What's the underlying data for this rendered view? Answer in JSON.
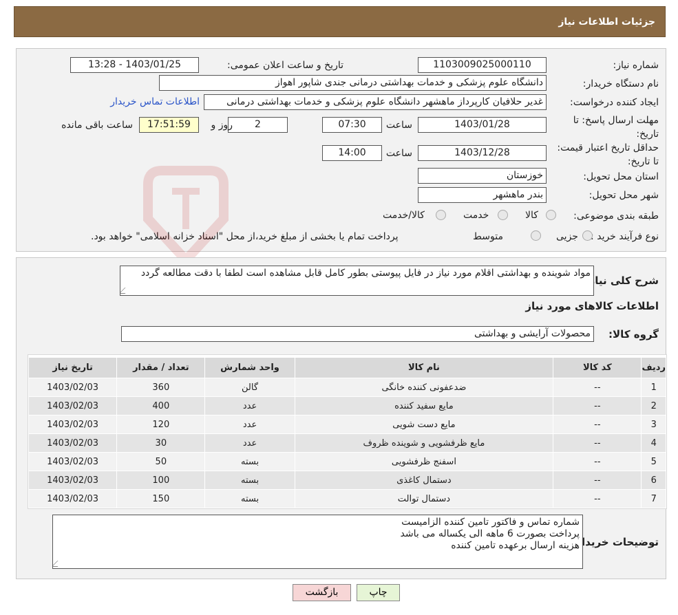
{
  "header": {
    "title": "جزئیات اطلاعات نیاز"
  },
  "form": {
    "need_number_label": "شماره نیاز:",
    "need_number": "1103009025000110",
    "announce_label": "تاریخ و ساعت اعلان عمومی:",
    "announce_value": "1403/01/25 - 13:28",
    "buyer_org_label": "نام دستگاه خریدار:",
    "buyer_org": "دانشگاه علوم پزشکی و خدمات بهداشتی درمانی جندی شاپور اهواز",
    "requester_label": "ایجاد کننده درخواست:",
    "requester": "غدیر حلافیان کارپرداز ماهشهر دانشگاه علوم پزشکی و خدمات بهداشتی درمانی",
    "contact_link": "اطلاعات تماس خریدار",
    "deadline_label": "مهلت ارسال پاسخ: تا تاریخ:",
    "deadline_date": "1403/01/28",
    "time_label": "ساعت",
    "deadline_time": "07:30",
    "days_value": "2",
    "days_label": "روز و",
    "remaining_time": "17:51:59",
    "remaining_label": "ساعت باقی مانده",
    "validity_label": "حداقل تاریخ اعتبار قیمت: تا تاریخ:",
    "validity_date": "1403/12/28",
    "validity_time": "14:00",
    "province_label": "استان محل تحویل:",
    "province": "خوزستان",
    "city_label": "شهر محل تحویل:",
    "city": "بندر ماهشهر",
    "category_label": "طبقه بندی موضوعی:",
    "category_options": [
      "کالا",
      "خدمت",
      "کالا/خدمت"
    ],
    "process_label": "نوع فرآیند خرید :",
    "process_options": [
      "جزیی",
      "متوسط"
    ],
    "process_note": "پرداخت تمام یا بخشی از مبلغ خرید،از محل \"اسناد خزانه اسلامی\" خواهد بود."
  },
  "summary": {
    "label": "شرح کلی نیاز:",
    "text": "مواد شوینده و بهداشتی اقلام مورد نیاز در فایل پیوستی بطور کامل قابل مشاهده است لطفا با دقت مطالعه گردد"
  },
  "items_section": {
    "title": "اطلاعات کالاهای مورد نیاز",
    "group_label": "گروه کالا:",
    "group_value": "محصولات آرایشی و بهداشتی"
  },
  "table": {
    "headers": [
      "ردیف",
      "کد کالا",
      "نام کالا",
      "واحد شمارش",
      "تعداد / مقدار",
      "تاریخ نیاز"
    ],
    "rows": [
      [
        "1",
        "--",
        "ضدعفونی کننده خانگی",
        "گالن",
        "360",
        "1403/02/03"
      ],
      [
        "2",
        "--",
        "مایع سفید کننده",
        "عدد",
        "400",
        "1403/02/03"
      ],
      [
        "3",
        "--",
        "مایع دست شویی",
        "عدد",
        "120",
        "1403/02/03"
      ],
      [
        "4",
        "--",
        "مایع ظرفشویی و شوینده ظروف",
        "عدد",
        "30",
        "1403/02/03"
      ],
      [
        "5",
        "--",
        "اسفنج ظرفشویی",
        "بسته",
        "50",
        "1403/02/03"
      ],
      [
        "6",
        "--",
        "دستمال کاغذی",
        "بسته",
        "100",
        "1403/02/03"
      ],
      [
        "7",
        "--",
        "دستمال توالت",
        "بسته",
        "150",
        "1403/02/03"
      ]
    ]
  },
  "buyer_notes": {
    "label": "توضیحات خریدار:",
    "lines": [
      "شماره تماس و فاکتور تامین کننده الزامیست",
      "پرداخت بصورت 6 ماهه الی یکساله می باشد",
      "هزینه ارسال برعهده تامین کننده"
    ]
  },
  "buttons": {
    "print": "چاپ",
    "back": "بازگشت"
  },
  "colors": {
    "header_bg": "#8b6a43",
    "link": "#2a54c8",
    "print_btn": "#e6f5d6",
    "back_btn": "#f7d6d6"
  }
}
